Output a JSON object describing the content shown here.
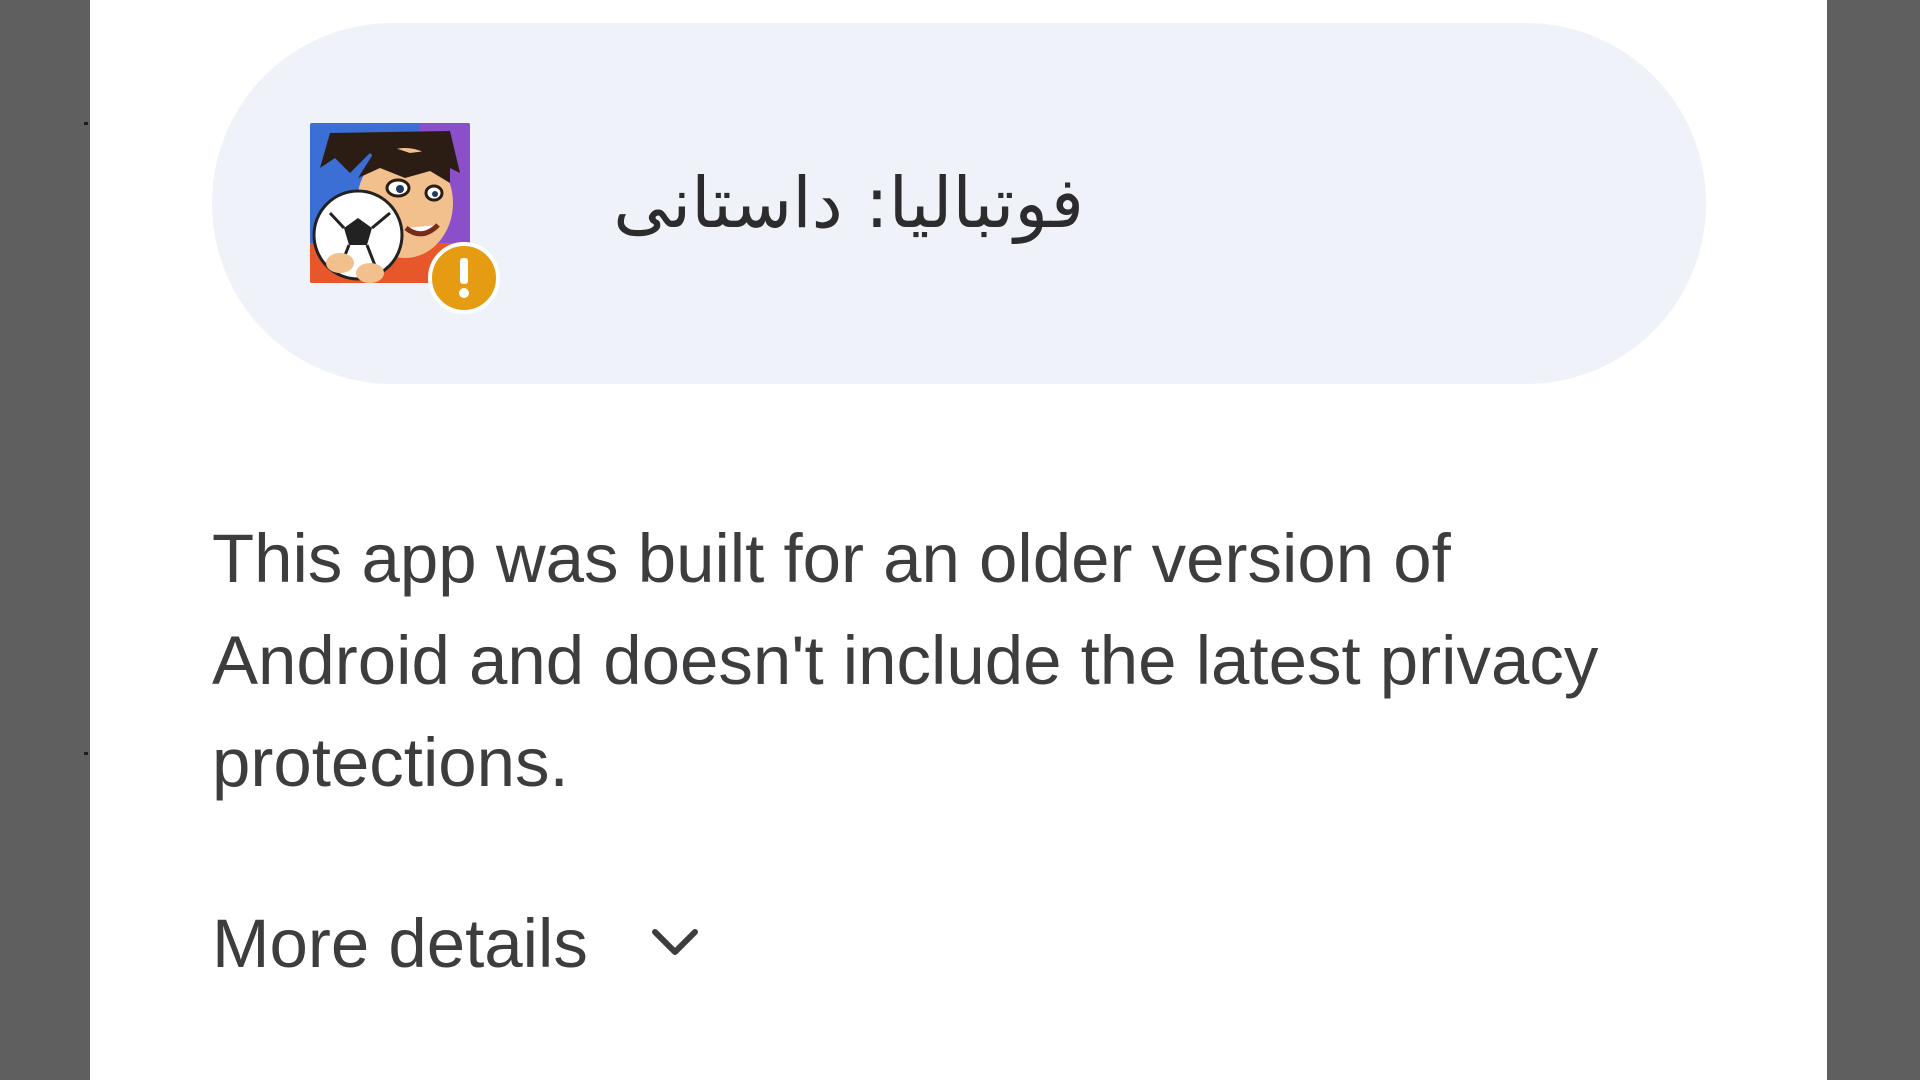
{
  "dialog": {
    "app_name": "فوتبالیا: داستانی",
    "app_icon": "footballer-cartoon-app-icon",
    "badge_icon": "warning-exclamation-icon",
    "description": "This app was built for an older version of Android and doesn't include the latest privacy protections.",
    "more_details_label": "More details",
    "more_details_icon": "chevron-down-icon"
  },
  "colors": {
    "backdrop": "#5f5f5f",
    "sheet": "#ffffff",
    "card": "#eff2f8",
    "warning": "#e69c12",
    "text": "#3d3d3f"
  }
}
